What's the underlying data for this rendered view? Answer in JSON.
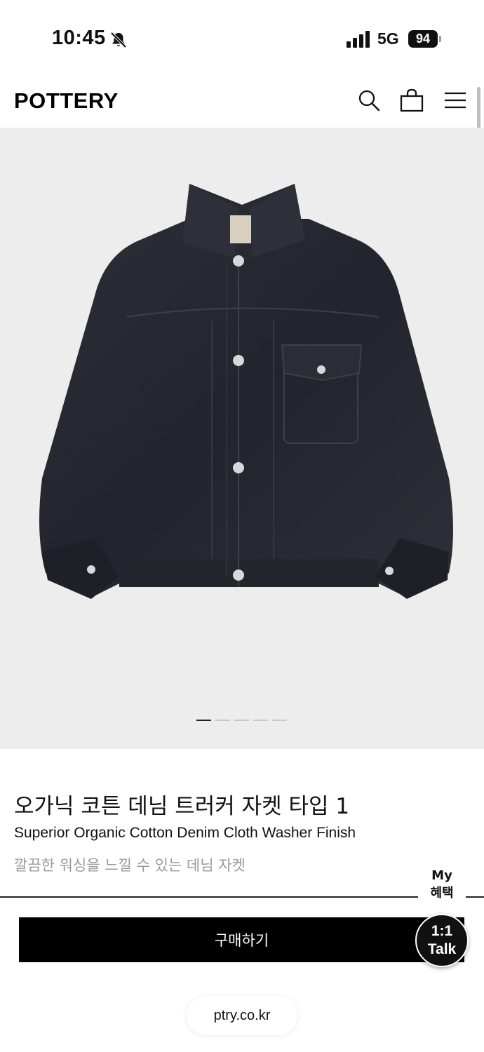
{
  "status_bar": {
    "time": "10:45",
    "network": "5G",
    "battery": "94",
    "icons": [
      "bell-slash-icon",
      "signal-bars-icon",
      "battery-icon"
    ]
  },
  "header": {
    "logo": "POTTERY",
    "icons": [
      "search-icon",
      "shopping-bag-icon",
      "hamburger-menu-icon"
    ]
  },
  "gallery": {
    "image": "dark-denim-jacket",
    "page_count": 5,
    "active_index": 0
  },
  "product": {
    "title": "오가닉 코튼 데님 트러커 자켓 타입 1",
    "subtitle": "Superior Organic Cotton Denim Cloth Washer Finish",
    "description": "깔끔한 워싱을 느낄 수 있는 데님 자켓"
  },
  "benefits": {
    "line1": "My",
    "line2": "혜택"
  },
  "buy": {
    "label": "구매하기"
  },
  "talk": {
    "line1": "1:1",
    "line2": "Talk"
  },
  "browser": {
    "url": "ptry.co.kr"
  },
  "colors": {
    "background": "#ffffff",
    "hero_bg": "#ededed",
    "button_bg": "#000000",
    "muted_text": "#9a9a9a",
    "jacket": "#22252c"
  }
}
